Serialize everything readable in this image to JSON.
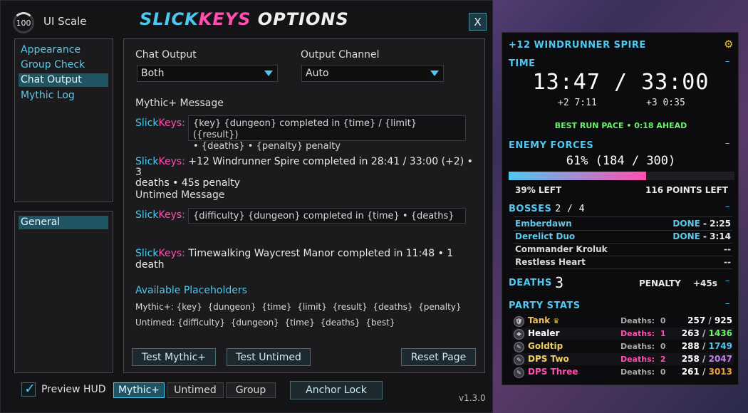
{
  "header": {
    "scale_value": "100",
    "scale_label": "UI Scale",
    "title_a": "SLICK",
    "title_b": "KEYS",
    "title_c": " OPTIONS",
    "close_label": "X"
  },
  "nav": {
    "items": [
      "Appearance",
      "Group Check",
      "Chat Output",
      "Mythic Log"
    ],
    "selected": "Chat Output",
    "sub_items": [
      "General"
    ]
  },
  "chat": {
    "chat_output_label": "Chat Output",
    "chat_output_value": "Both",
    "output_channel_label": "Output Channel",
    "output_channel_value": "Auto",
    "mythic_label": "Mythic+ Message",
    "prefix_a": "Slick",
    "prefix_b": "Keys:",
    "mythic_template_l1": "{key} {dungeon} completed in {time} / {limit} ({result})",
    "mythic_template_l2": "• {deaths} • {penalty} penalty",
    "mythic_preview_l1": " +12 Windrunner Spire completed in 28:41 / 33:00 (+2) • 3",
    "mythic_preview_l2": "deaths • 45s penalty",
    "untimed_label": "Untimed Message",
    "untimed_template": "{difficulty} {dungeon} completed in {time} • {deaths}",
    "untimed_preview": " Timewalking Waycrest Manor completed in 11:48 • 1 death",
    "placeholders_label": "Available Placeholders",
    "placeholders_mythic": "Mythic+: {key}  {dungeon}  {time}  {limit}  {result}  {deaths}  {penalty}",
    "placeholders_untimed": "Untimed: {difficulty}  {dungeon}  {time}  {deaths}  {best}",
    "test_mythic": "Test Mythic+",
    "test_untimed": "Test Untimed",
    "reset_page": "Reset Page"
  },
  "footer": {
    "preview_hud": "Preview HUD",
    "preview_checked": true,
    "mode_tabs": [
      "Mythic+",
      "Untimed",
      "Group"
    ],
    "active_mode": "Mythic+",
    "anchor_lock": "Anchor Lock",
    "version": "v1.3.0"
  },
  "hud": {
    "dungeon": "+12  WINDRUNNER SPIRE",
    "time_label": "TIME",
    "timer": "13:47 / 33:00",
    "plus2": "+2  7:11",
    "plus3": "+3  0:35",
    "best_run_a": "BEST RUN PACE",
    "best_run_dot": "•",
    "best_run_b": "0:18 AHEAD",
    "enemy_label": "ENEMY FORCES",
    "enemy_value": "61%  (184 / 300)",
    "enemy_progress": 0.61,
    "enemy_left": "39% LEFT",
    "enemy_points_left": "116 POINTS LEFT",
    "bosses_label": "BOSSES",
    "bosses_count": "2 / 4",
    "bosses": [
      {
        "name": "Emberdawn",
        "status": "DONE",
        "time": " - 2:25",
        "done": true
      },
      {
        "name": "Derelict Duo",
        "status": "DONE",
        "time": " - 3:14",
        "done": true
      },
      {
        "name": "Commander Kroluk",
        "status": "--",
        "time": "",
        "done": false
      },
      {
        "name": "Restless Heart",
        "status": "--",
        "time": "",
        "done": false
      }
    ],
    "deaths_label": "DEATHS",
    "deaths_value": "3",
    "penalty_label": "PENALTY",
    "penalty_value": "+45s",
    "party_label": "PARTY STATS",
    "party": [
      {
        "name": "Tank",
        "deaths_label": "Deaths:",
        "deaths": "0",
        "a": "257",
        "b": "925",
        "name_color": "#f0c060",
        "b_color": "#ffffff",
        "crown": true,
        "highlight": false
      },
      {
        "name": "Healer",
        "deaths_label": "Deaths:",
        "deaths": "1",
        "a": "263",
        "b": "1436",
        "name_color": "#ffffff",
        "b_color": "#6cf06c",
        "crown": false,
        "highlight": true
      },
      {
        "name": "Goldtip",
        "deaths_label": "Deaths:",
        "deaths": "0",
        "a": "288",
        "b": "1749",
        "name_color": "#f0d060",
        "b_color": "#4ec8f0",
        "crown": false,
        "highlight": false
      },
      {
        "name": "DPS Two",
        "deaths_label": "Deaths:",
        "deaths": "2",
        "a": "258",
        "b": "2047",
        "name_color": "#f0d060",
        "b_color": "#c080f0",
        "crown": false,
        "highlight": true
      },
      {
        "name": "DPS Three",
        "deaths_label": "Deaths:",
        "deaths": "0",
        "a": "261",
        "b": "3013",
        "name_color": "#ff4fb0",
        "b_color": "#f0a040",
        "crown": false,
        "highlight": false
      }
    ]
  },
  "colors": {
    "cyan": "#4ec8f0",
    "pink": "#ff4fb0",
    "green": "#6cf06c"
  }
}
